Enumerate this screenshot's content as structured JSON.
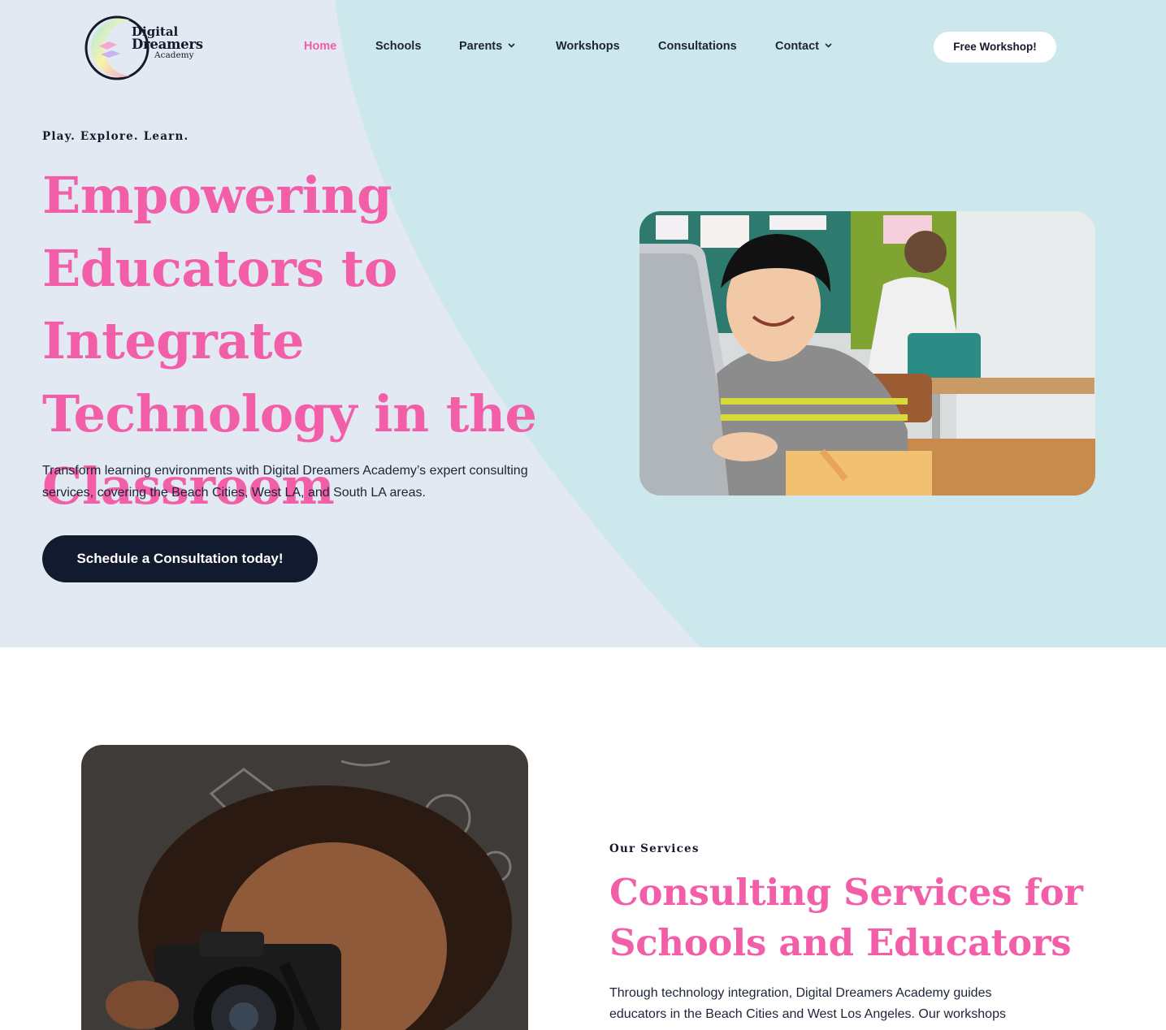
{
  "brand": {
    "line1": "Digital",
    "line2": "Dreamers",
    "line3": "Academy"
  },
  "nav": {
    "items": [
      {
        "label": "Home",
        "active": true
      },
      {
        "label": "Schools"
      },
      {
        "label": "Parents",
        "icon": "chevron-down-icon"
      },
      {
        "label": "Workshops"
      },
      {
        "label": "Consultations"
      },
      {
        "label": "Contact",
        "icon": "chevron-down-icon"
      }
    ],
    "cta_label": "Free Workshop!"
  },
  "hero": {
    "eyebrow": "Play. Explore. Learn.",
    "title_lines": [
      "Empowering",
      "Educators to Integrate",
      "Technology in the",
      "Classroom"
    ],
    "subtitle_lines": [
      "Transform learning environments with Digital Dreamers Academy’s expert consulting",
      "services, covering the Beach Cities, West LA, and South LA areas."
    ],
    "button_label": "Schedule a Consultation today!",
    "image": "smiling-boy-at-laptop-in-classroom-photo"
  },
  "services": {
    "eyebrow": "Our Services",
    "title_lines": [
      "Consulting Services for",
      "Schools and Educators"
    ],
    "text_lines": [
      "Through technology integration, Digital Dreamers Academy guides",
      "educators in the Beach Cities and West Los Angeles. Our workshops"
    ],
    "image": "girl-with-camera-photo"
  },
  "colors": {
    "accent_pink": "#f25fa8",
    "hero_bg": "#e2e9f2",
    "hero_shape": "#cde8ec",
    "dark_button": "#111a2e"
  }
}
